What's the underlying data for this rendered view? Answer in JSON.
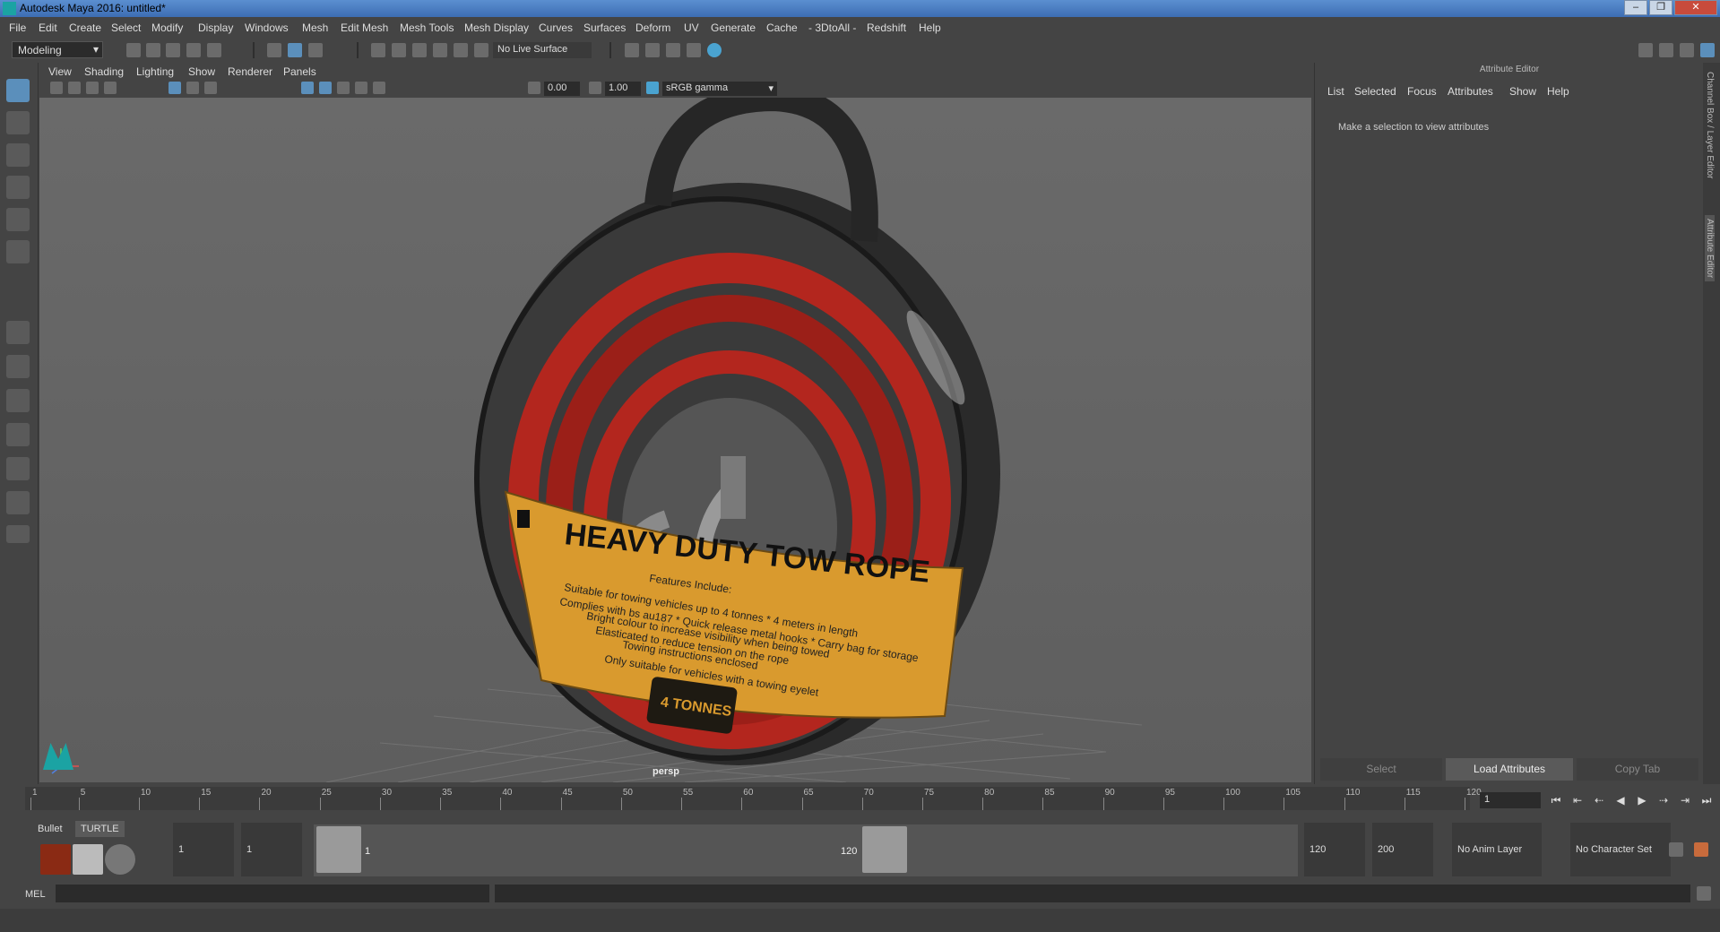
{
  "window": {
    "title": "Autodesk Maya 2016: untitled*",
    "controls": [
      "–",
      "❐",
      "✕"
    ]
  },
  "menubar": [
    "File",
    "Edit",
    "Create",
    "Select",
    "Modify",
    "Display",
    "Windows",
    "Mesh",
    "Edit Mesh",
    "Mesh Tools",
    "Mesh Display",
    "Curves",
    "Surfaces",
    "Deform",
    "UV",
    "Generate",
    "Cache",
    "- 3DtoAll -",
    "Redshift",
    "Help"
  ],
  "statusline": {
    "mode": "Modeling",
    "live_surface": "No Live Surface"
  },
  "viewport": {
    "menus": [
      "View",
      "Shading",
      "Lighting",
      "Show",
      "Renderer",
      "Panels"
    ],
    "exposure": "0.00",
    "gamma": "1.00",
    "color_space": "sRGB gamma",
    "camera_label": "persp",
    "model": {
      "title": "HEAVY DUTY TOW ROPE",
      "features_heading": "Features Include:",
      "features": [
        "Suitable for towing vehicles up to 4 tonnes * 4 meters in length",
        "Complies with bs au187 * Quick release metal hooks * Carry bag for storage",
        "Bright colour to increase visibility when being towed",
        "Elasticated to reduce tension on the rope",
        "Towing instructions enclosed",
        "Only suitable for vehicles with a towing eyelet"
      ],
      "badge": "4 TONNES"
    }
  },
  "attribute_editor": {
    "header": "Attribute Editor",
    "menus": [
      "List",
      "Selected",
      "Focus",
      "Attributes",
      "Show",
      "Help"
    ],
    "message": "Make a selection to view attributes",
    "buttons": [
      "Select",
      "Load Attributes",
      "Copy Tab"
    ],
    "side_tabs": [
      "Channel Box / Layer Editor",
      "Attribute Editor"
    ]
  },
  "timeline": {
    "ticks": [
      "1",
      "5",
      "10",
      "15",
      "20",
      "25",
      "30",
      "35",
      "40",
      "45",
      "50",
      "55",
      "60",
      "65",
      "70",
      "75",
      "80",
      "85",
      "90",
      "95",
      "100",
      "105",
      "110",
      "115",
      "120"
    ],
    "current_frame": "1"
  },
  "range": {
    "shelf_tabs": [
      "Bullet",
      "TURTLE"
    ],
    "start": "1",
    "playback_start": "1",
    "range_start_label": "1",
    "range_end_label": "120",
    "playback_end": "120",
    "end": "200",
    "anim_layer": "No Anim Layer",
    "character_set": "No Character Set"
  },
  "command": {
    "mode": "MEL"
  },
  "colors": {
    "accent": "#5b8fbb",
    "rope": "#b3261e",
    "label": "#d99a2e"
  }
}
